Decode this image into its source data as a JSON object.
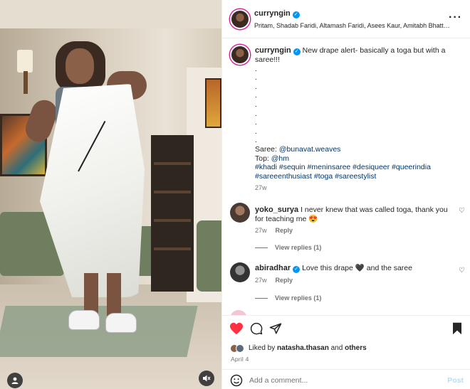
{
  "post": {
    "username": "curryngin",
    "audio": "Pritam, Shadab Faridi, Altamash Faridi, Asees Kaur, Amitabh Bhattacha...",
    "caption_text": "New drape alert- basically a toga but with a saree!!!",
    "caption_dots": [
      ".",
      ".",
      ".",
      ".",
      ".",
      ".",
      ".",
      ".",
      "."
    ],
    "caption_saree_label": "Saree: ",
    "caption_saree_handle": "@bunavat.weaves",
    "caption_top_label": "Top: ",
    "caption_top_handle": "@hm",
    "hashtags_line1": "#khadi #sequin #meninsaree #desiqueer #queerindia",
    "hashtags_line2": "#sareeenthusiast #toga #sareestylist",
    "caption_time": "27w"
  },
  "comments": [
    {
      "username": "yoko_surya",
      "text": "I never knew that was called toga, thank you for teaching me 😍",
      "time": "27w",
      "reply_label": "Reply",
      "view_replies": "View replies (1)"
    },
    {
      "username": "abiradhar",
      "text": "Love this drape 🖤 and the saree",
      "time": "27w",
      "reply_label": "Reply",
      "view_replies": "View replies (1)"
    }
  ],
  "likes": {
    "prefix": "Liked by ",
    "user": "natasha.thasan",
    "middle": " and ",
    "others": "others"
  },
  "date": "April 4",
  "add_comment": {
    "placeholder": "Add a comment...",
    "post_label": "Post"
  },
  "icons": {
    "like": "heart-filled-icon",
    "comment": "comment-icon",
    "share": "paper-plane-icon",
    "save": "bookmark-filled-icon",
    "more": "more-horizontal-icon",
    "emoji": "emoji-icon",
    "mute": "muted-speaker-icon",
    "tag": "user-tag-icon"
  },
  "colors": {
    "like_red": "#ff3040",
    "verified_blue": "#0095f6",
    "link_blue": "#00376b",
    "post_disabled": "#b2dffc"
  }
}
